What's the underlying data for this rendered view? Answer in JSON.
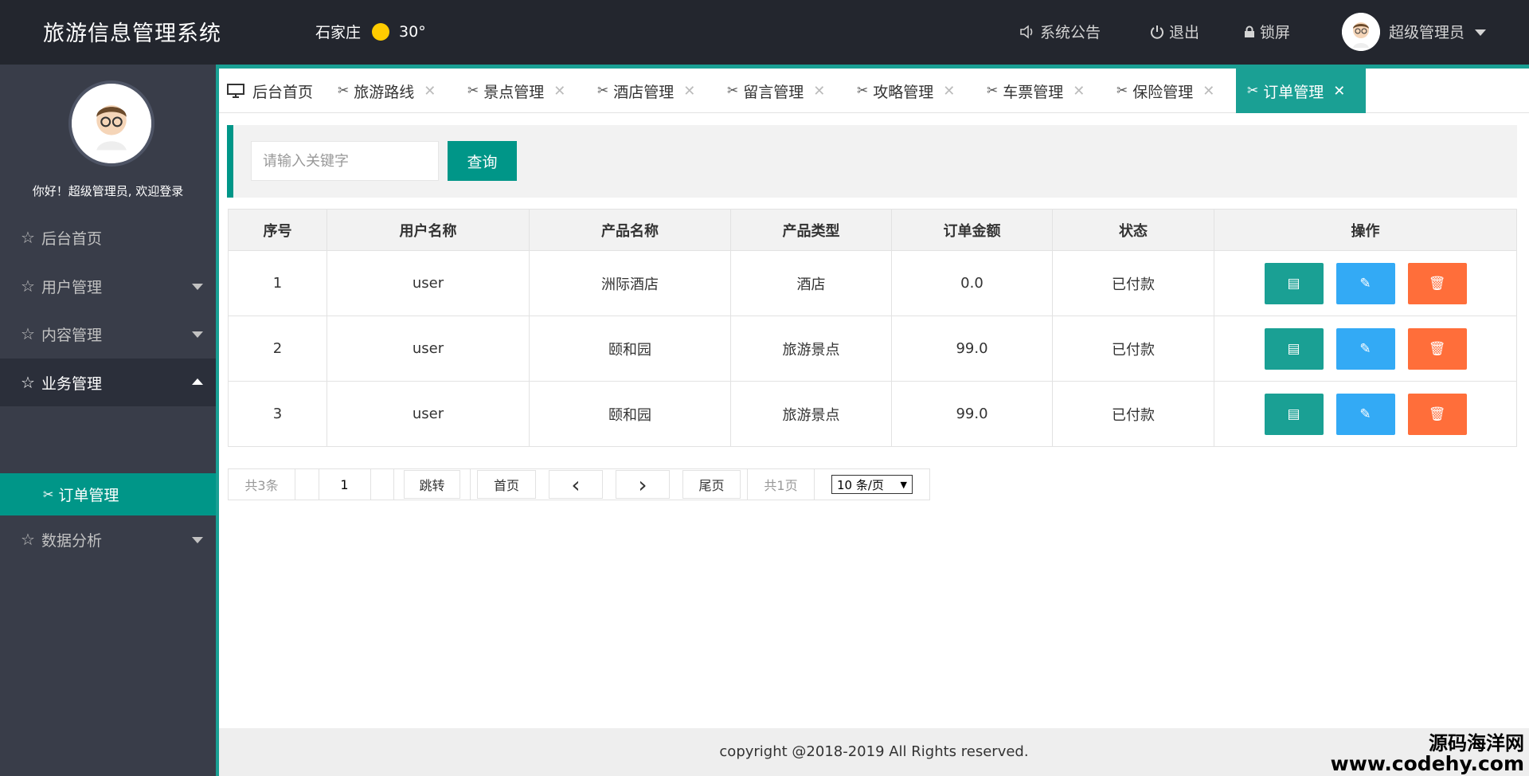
{
  "header": {
    "title": "旅游信息管理系统",
    "city": "石家庄",
    "temperature": "30°",
    "notice": "系统公告",
    "logout": "退出",
    "lock": "锁屏",
    "user": "超级管理员"
  },
  "sidebar": {
    "welcome": "你好！超级管理员, 欢迎登录",
    "items": [
      {
        "label": "后台首页"
      },
      {
        "label": "用户管理"
      },
      {
        "label": "内容管理"
      },
      {
        "label": "业务管理"
      },
      {
        "label": "数据分析"
      }
    ],
    "sub_active": "订单管理"
  },
  "tabs": [
    {
      "label": "后台首页",
      "icon": "monitor-icon"
    },
    {
      "label": "旅游路线",
      "icon": "tools-icon"
    },
    {
      "label": "景点管理",
      "icon": "tools-icon"
    },
    {
      "label": "酒店管理",
      "icon": "tools-icon"
    },
    {
      "label": "留言管理",
      "icon": "tools-icon"
    },
    {
      "label": "攻略管理",
      "icon": "tools-icon"
    },
    {
      "label": "车票管理",
      "icon": "tools-icon"
    },
    {
      "label": "保险管理",
      "icon": "tools-icon"
    },
    {
      "label": "订单管理",
      "icon": "tools-icon"
    }
  ],
  "search": {
    "placeholder": "请输入关键字",
    "button": "查询"
  },
  "table": {
    "headers": [
      "序号",
      "用户名称",
      "产品名称",
      "产品类型",
      "订单金额",
      "状态",
      "操作"
    ],
    "rows": [
      [
        "1",
        "user",
        "洲际酒店",
        "酒店",
        "0.0",
        "已付款"
      ],
      [
        "2",
        "user",
        "颐和园",
        "旅游景点",
        "99.0",
        "已付款"
      ],
      [
        "3",
        "user",
        "颐和园",
        "旅游景点",
        "99.0",
        "已付款"
      ]
    ]
  },
  "pager": {
    "total": "共3条",
    "page_value": "1",
    "jump": "跳转",
    "first": "首页",
    "prev": "‹",
    "next": "›",
    "last": "尾页",
    "pages": "共1页",
    "per_page": "10 条/页"
  },
  "footer": {
    "copyright": "copyright @2018-2019 All Rights reserved."
  },
  "watermark": {
    "line1": "源码海洋网",
    "line2": "www.codehy.com"
  },
  "colors": {
    "header_bg": "#23262e",
    "sidebar_bg": "#393d49",
    "accent": "#009688",
    "edit": "#33aaf5",
    "delete": "#ff6e3a"
  }
}
